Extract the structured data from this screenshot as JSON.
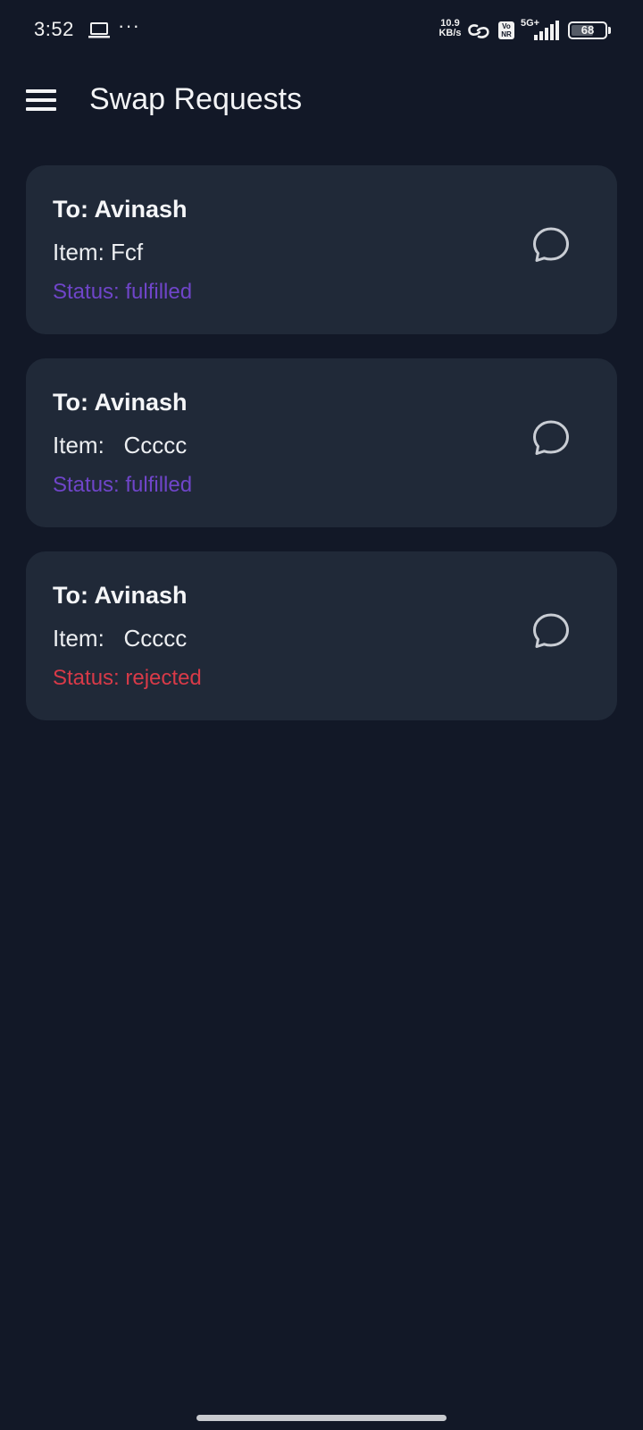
{
  "status_bar": {
    "time": "3:52",
    "dots": "···",
    "speed_value": "10.9",
    "speed_unit": "KB/s",
    "vonr_top": "Vo",
    "vonr_bottom": "NR",
    "network": "5G+",
    "battery": "68",
    "battery_level": 0.68,
    "icons": [
      "laptop-icon",
      "link-icon",
      "signal-icon",
      "battery-icon"
    ]
  },
  "app_bar": {
    "title": "Swap Requests",
    "menu_icon": "hamburger-menu-icon"
  },
  "colors": {
    "background": "#121827",
    "card": "#202938",
    "status_fulfilled": "#6f45c9",
    "status_rejected": "#d83a48"
  },
  "requests": [
    {
      "to": "To: Avinash",
      "item": "Item: Fcf",
      "status": "Status: fulfilled",
      "status_key": "fulfilled"
    },
    {
      "to": "To: Avinash",
      "item": "Item:   Ccccc",
      "status": "Status: fulfilled",
      "status_key": "fulfilled"
    },
    {
      "to": "To: Avinash",
      "item": "Item:   Ccccc",
      "status": "Status: rejected",
      "status_key": "rejected"
    }
  ]
}
